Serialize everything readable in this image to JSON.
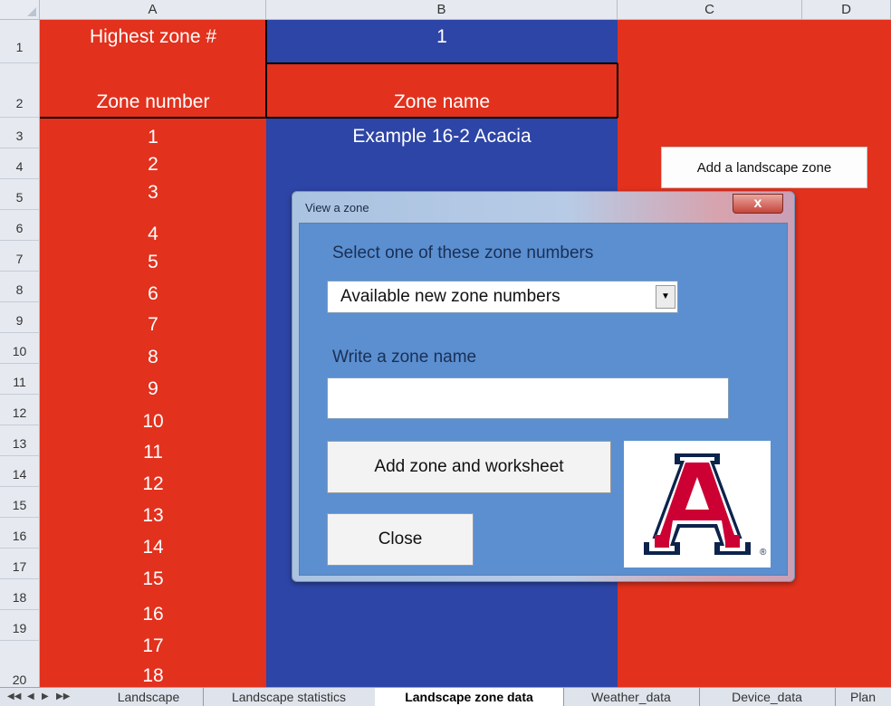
{
  "columns": [
    "A",
    "B",
    "C",
    "D"
  ],
  "rows": [
    "1",
    "2",
    "3",
    "4",
    "5",
    "6",
    "7",
    "8",
    "9",
    "10",
    "11",
    "12",
    "13",
    "14",
    "15",
    "16",
    "17",
    "18",
    "19",
    "20"
  ],
  "colors": {
    "red": "#e2311d",
    "blue": "#2d45a6",
    "header": "#e6eaf0"
  },
  "cells": {
    "a1": "Highest zone #",
    "b1": "1",
    "a2": "Zone number",
    "b2": "Zone name",
    "b3": "Example 16-2 Acacia",
    "zone_numbers": [
      "1",
      "2",
      "3",
      "4",
      "5",
      "6",
      "7",
      "8",
      "9",
      "10",
      "11",
      "12",
      "13",
      "14",
      "15",
      "16",
      "17",
      "18"
    ]
  },
  "add_landscape_zone_button": "Add a landscape zone",
  "dialog": {
    "title": "View a zone",
    "close_icon": "x-close-icon",
    "close_glyph": "x",
    "select_label": "Select one of these zone numbers",
    "select_value": "Available new zone numbers",
    "name_label": "Write a zone name",
    "name_value": "",
    "add_button": "Add zone and worksheet",
    "close_button": "Close",
    "logo_letter": "A",
    "logo_mark": "®"
  },
  "sheet_tabs": [
    "Landscape",
    "Landscape statistics",
    "Landscape zone data",
    "Weather_data",
    "Device_data",
    "Plan"
  ],
  "active_tab": "Landscape zone data"
}
